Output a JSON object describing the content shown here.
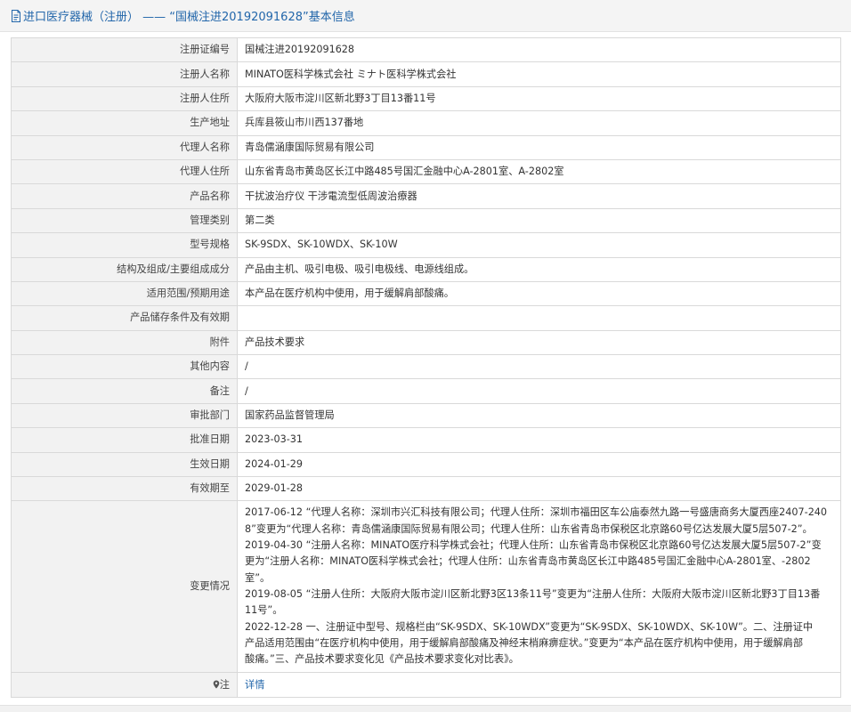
{
  "header": {
    "title": "进口医疗器械（注册） —— “国械注进20192091628”基本信息"
  },
  "rows": [
    {
      "label": "注册证编号",
      "value": "国械注进20192091628"
    },
    {
      "label": "注册人名称",
      "value": "MINATO医科学株式会社 ミナト医科学株式会社"
    },
    {
      "label": "注册人住所",
      "value": "大阪府大阪市淀川区新北野3丁目13番11号"
    },
    {
      "label": "生产地址",
      "value": "兵库县筱山市川西137番地"
    },
    {
      "label": "代理人名称",
      "value": "青岛儒涵康国际贸易有限公司"
    },
    {
      "label": "代理人住所",
      "value": "山东省青岛市黄岛区长江中路485号国汇金融中心A-2801室、A-2802室"
    },
    {
      "label": "产品名称",
      "value": "干扰波治疗仪 干涉電流型低周波治療器"
    },
    {
      "label": "管理类别",
      "value": "第二类"
    },
    {
      "label": "型号规格",
      "value": "SK-9SDX、SK-10WDX、SK-10W"
    },
    {
      "label": "结构及组成/主要组成成分",
      "value": "产品由主机、吸引电极、吸引电极线、电源线组成。"
    },
    {
      "label": "适用范围/预期用途",
      "value": "本产品在医疗机构中使用，用于缓解肩部酸痛。"
    },
    {
      "label": "产品储存条件及有效期",
      "value": ""
    },
    {
      "label": "附件",
      "value": "产品技术要求"
    },
    {
      "label": "其他内容",
      "value": "/"
    },
    {
      "label": "备注",
      "value": "/"
    },
    {
      "label": "审批部门",
      "value": "国家药品监督管理局"
    },
    {
      "label": "批准日期",
      "value": "2023-03-31"
    },
    {
      "label": "生效日期",
      "value": "2024-01-29"
    },
    {
      "label": "有效期至",
      "value": "2029-01-28"
    }
  ],
  "changes": {
    "label": "变更情况",
    "lines": [
      "2017-06-12 “代理人名称：深圳市兴汇科技有限公司；代理人住所：深圳市福田区车公庙泰然九路一号盛唐商务大厦西座2407-240",
      "8”变更为“代理人名称：青岛儒涵康国际贸易有限公司；代理人住所：山东省青岛市保税区北京路60号亿达发展大厦5层507-2”。",
      "2019-04-30 “注册人名称：MINATO医疗科学株式会社；代理人住所：山东省青岛市保税区北京路60号亿达发展大厦5层507-2”变",
      "更为“注册人名称：MINATO医科学株式会社；代理人住所：山东省青岛市黄岛区长江中路485号国汇金融中心A-2801室、-2802",
      "室”。",
      "2019-08-05 “注册人住所：大阪府大阪市淀川区新北野3区13条11号”变更为“注册人住所：大阪府大阪市淀川区新北野3丁目13番",
      "11号”。",
      "2022-12-28 一、注册证中型号、规格栏由“SK-9SDX、SK-10WDX”变更为“SK-9SDX、SK-10WDX、SK-10W”。二、注册证中",
      "产品适用范围由“在医疗机构中使用，用于缓解肩部酸痛及神经末梢麻痹症状。”变更为“本产品在医疗机构中使用，用于缓解肩部",
      "酸痛。”三、产品技术要求变化见《产品技术要求变化对比表》。"
    ]
  },
  "note": {
    "label": "注",
    "link": "详情"
  },
  "icons": {
    "header": "document-icon",
    "note": "location-pin-icon"
  },
  "colors": {
    "link": "#2266aa",
    "label_bg": "#f2f2f2",
    "border": "#d9d9d9"
  }
}
